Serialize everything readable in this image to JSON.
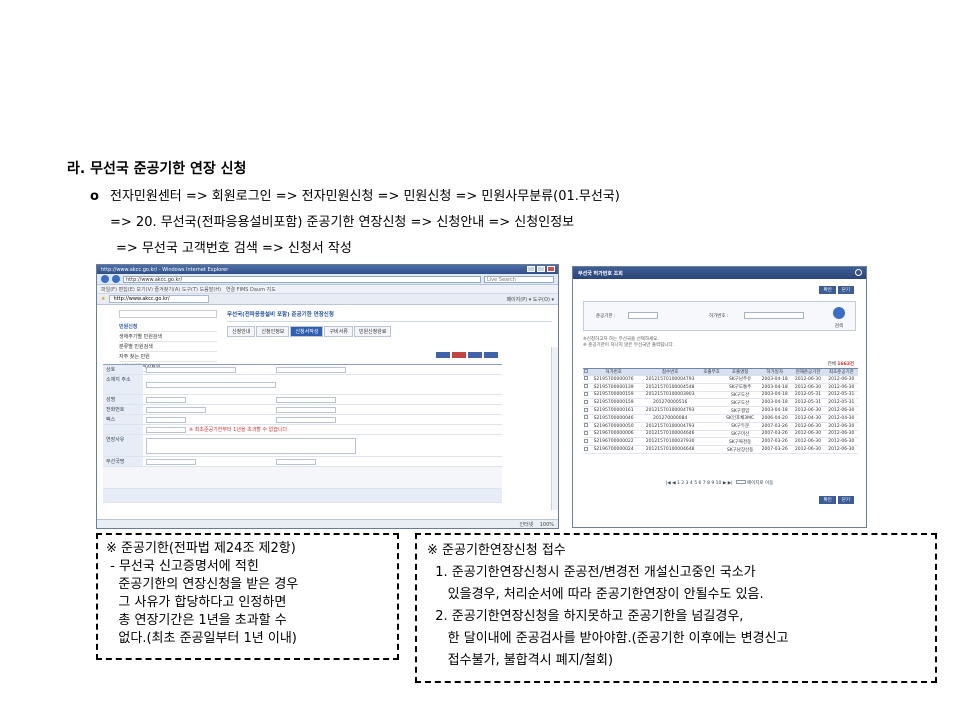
{
  "section": {
    "heading": "라. 무선국 준공기한 연장 신청",
    "bullet_mark": "o",
    "path_line1": "전자민원센터 => 회원로그인 => 전자민원신청 => 민원신청 => 민원사무분류(01.무선국)",
    "path_line2": "=> 20. 무선국(전파응용설비포함) 준공기한 연장신청 => 신청안내 => 신청인정보",
    "path_line3": "=> 무선국 고객번호 검색 => 신청서 작성"
  },
  "browser_screenshot": {
    "window_title": "http://www.akcc.go.kr/ - Windows Internet Explorer",
    "url": "http://www.akcc.go.kr/",
    "search_placeholder": "Live Search",
    "menu": "파일(F)  편집(E)  보기(V)  즐겨찾기(A)  도구(T)  도움말(H)",
    "links": "연결  FIMS  Daum 지도",
    "tab_url": "http://www.akcc.go.kr/",
    "toolbar_right": "페이지(P) ▾  도구(O) ▾",
    "sidebar": [
      "민원신청",
      "생애주기별 민원검색",
      "분류별 민원검색",
      "자주 찾는 민원",
      "민원신청양식자료실"
    ],
    "page_title": "무선국(전파응용설비 포함) 준공기한 연장신청",
    "tabs": [
      "신청안내",
      "신청인정보",
      "신청서작성",
      "구비서류",
      "민원신청완료"
    ],
    "form_labels": [
      "상호",
      "소재지 주소",
      "성명",
      "전화번호",
      "팩스",
      "연장사유",
      "무선국명"
    ],
    "form_note": "※ 최초준공기한부터 1년을 초과할 수 없습니다.",
    "zoom": "100%",
    "status_zone": "인터넷"
  },
  "popup_screenshot": {
    "title": "무선국 허가번호 조회",
    "buttons": [
      "확인",
      "닫기"
    ],
    "label_station": "준공기한 :",
    "label_permit": "허가번호 :",
    "search_label": "검색",
    "hint": "※신청하고자 하는 무선국을 선택하세요.\n※ 준공기한이 지나지 않은 무선국만 출력됩니다.",
    "count_label": "전체",
    "count_value": "1663건",
    "columns": [
      "",
      "허가번호",
      "접수번호",
      "호출부호",
      "호출명칭",
      "허가일자",
      "현재준공기한",
      "최초준공기한"
    ],
    "rows": [
      [
        "S2195700000076",
        "20121570100004793",
        "SK구남주유",
        "2003-04-18",
        "2012-06-30",
        "2012-06-30"
      ],
      [
        "S2195700000139",
        "20121570100004548",
        "SK구도통주",
        "2003-04-18",
        "2012-06-30",
        "2012-06-30"
      ],
      [
        "S2195700000159",
        "20121570100003903",
        "SK구도산",
        "2003-04-18",
        "2012-05-31",
        "2012-05-31"
      ],
      [
        "S2195700000159",
        "201270000516",
        "SK구도산",
        "2003-04-18",
        "2012-05-31",
        "2012-05-31"
      ],
      [
        "S2195700000161",
        "20121570100004793",
        "SK구결암",
        "2003-04-18",
        "2012-06-30",
        "2012-06-30"
      ],
      [
        "S2195700000046",
        "201270000084",
        "SK인포채3MC",
        "2006-04-20",
        "2012-04-30",
        "2012-04-30"
      ],
      [
        "S2196700000050",
        "20121570100004793",
        "SK구두문",
        "2007-03-26",
        "2012-06-30",
        "2012-06-30"
      ],
      [
        "S2196700000006",
        "20121570100004646",
        "SK구미산",
        "2007-03-26",
        "2012-06-30",
        "2012-06-30"
      ],
      [
        "S2196700000022",
        "20121570100037930",
        "SK구복천동",
        "2007-03-26",
        "2012-06-30",
        "2012-06-30"
      ],
      [
        "S2196700000024",
        "20121570100004648",
        "SK구남장산동",
        "2007-03-26",
        "2012-06-30",
        "2012-06-30"
      ]
    ],
    "pager": "|◀ ◀ 1 2 3 4 5 6 7 8 9 10 ▶ ▶|",
    "pager_current": "1",
    "pager_goto": "페이지로 이동"
  },
  "note_left": {
    "lines": [
      "※ 준공기한(전파법 제24조 제2항)",
      " - 무선국 신고증명서에 적힌",
      "   준공기한의 연장신청을 받은 경우",
      "   그 사유가 합당하다고 인정하면",
      "   총 연장기간은 1년을 초과할 수",
      "   없다.(최초 준공일부터 1년 이내)"
    ]
  },
  "note_right": {
    "lines": [
      "※ 준공기한연장신청 접수",
      "  1. 준공기한연장신청시 준공전/변경전 개설신고중인 국소가",
      "     있을경우, 처리순서에 따라 준공기한연장이 안될수도 있음.",
      "  2. 준공기한연장신청을 하지못하고 준공기한을 넘길경우,",
      "     한 달이내에 준공검사를 받아야함.(준공기한 이후에는 변경신고",
      "     접수불가, 불합격시 폐지/철회)"
    ]
  }
}
